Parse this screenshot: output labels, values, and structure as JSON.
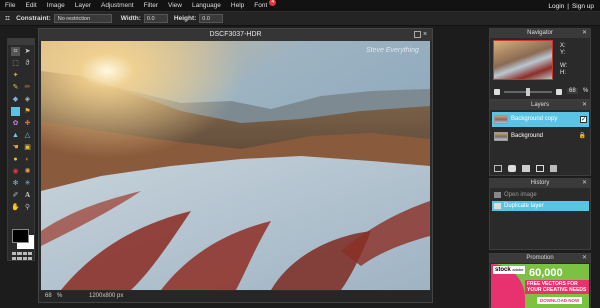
{
  "menubar": {
    "items": [
      "File",
      "Edit",
      "Image",
      "Layer",
      "Adjustment",
      "Filter",
      "View",
      "Language",
      "Help",
      "Font"
    ],
    "font_badge": "4",
    "login": "Login",
    "separator": "|",
    "signup": "Sign up"
  },
  "options": {
    "constraint_label": "Constraint:",
    "constraint_value": "No restriction",
    "width_label": "Width:",
    "width_value": "0.0",
    "height_label": "Height:",
    "height_value": "0.0"
  },
  "canvas": {
    "title": "DSCF3037-HDR",
    "watermark": "Steve Everything",
    "zoom": "68",
    "zoom_unit": "%",
    "dimensions": "1200x800 px"
  },
  "navigator": {
    "title": "Navigator",
    "x_label": "X:",
    "y_label": "Y:",
    "w_label": "W:",
    "h_label": "H:",
    "zoom": "68",
    "zoom_unit": "%"
  },
  "layers": {
    "title": "Layers",
    "items": [
      {
        "name": "Background copy",
        "selected": true
      },
      {
        "name": "Background",
        "selected": false
      }
    ]
  },
  "history": {
    "title": "History",
    "items": [
      {
        "name": "Open image",
        "selected": false
      },
      {
        "name": "Duplicate layer",
        "selected": true
      }
    ]
  },
  "promotion": {
    "title": "Promotion",
    "brand": "stock",
    "brand_sub": "adobe",
    "count": "60,000",
    "line1": "FREE VECTORS FOR",
    "line2": "YOUR CREATIVE NEEDS",
    "cta": "DOWNLOAD NOW"
  },
  "colors": {
    "accent": "#5bc4e5",
    "badge": "#e0353b",
    "promo_bg": "#7cc242",
    "promo_banner": "#e8316f"
  }
}
